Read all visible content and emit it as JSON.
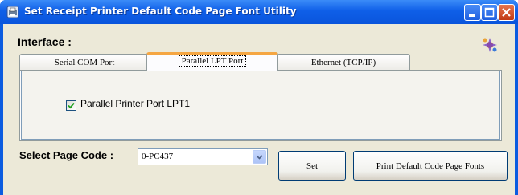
{
  "window": {
    "title": "Set Receipt Printer Default Code Page Font Utility",
    "app_icon": "printer-app-icon",
    "controls": [
      "minimize-icon",
      "maximize-icon",
      "close-icon"
    ]
  },
  "interface": {
    "label": "Interface :",
    "corner_icon": "puzzle-icon",
    "tabs": [
      {
        "label": "Serial COM Port",
        "active": false
      },
      {
        "label": "Parallel LPT Port",
        "active": true
      },
      {
        "label": "Ethernet (TCP/IP)",
        "active": false
      }
    ],
    "parallel_panel": {
      "checkbox_label": "Parallel Printer Port LPT1",
      "checked": true
    }
  },
  "page_code": {
    "label": "Select Page Code :",
    "selected": "0-PC437"
  },
  "buttons": {
    "set_label": "Set",
    "print_label": "Print Default Code Page Fonts"
  },
  "colors": {
    "titlebar": "#0a55dc",
    "client_bg": "#ece9d8",
    "active_tab_accent": "#f5a642"
  }
}
